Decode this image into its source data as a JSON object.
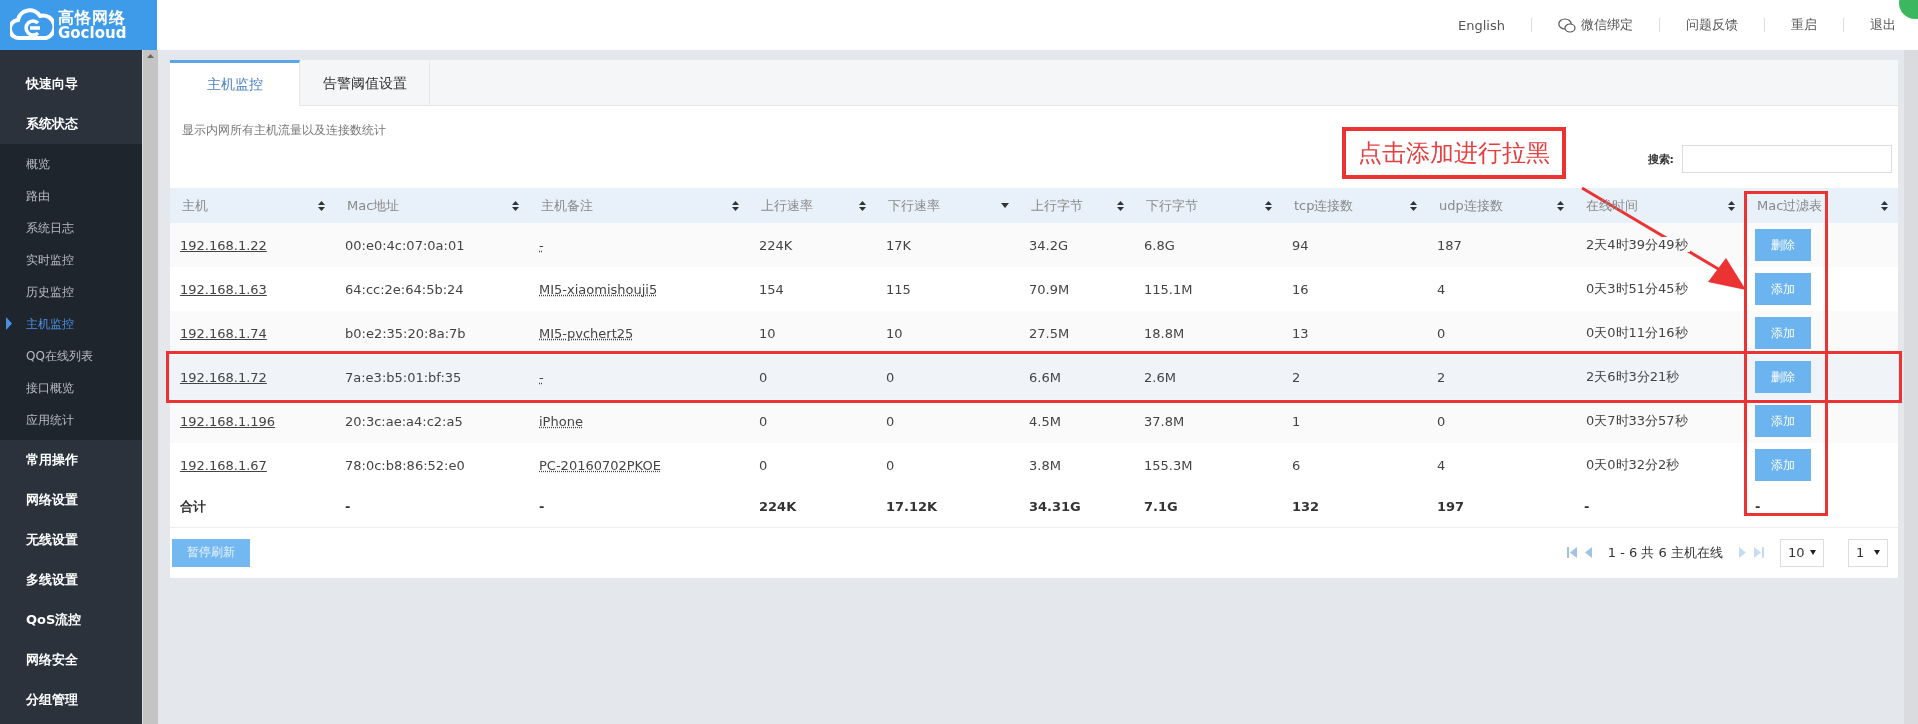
{
  "brand": {
    "name": "高恪网络",
    "subtitle": "Gocloud"
  },
  "top_links": [
    {
      "label": "English",
      "kind": "text"
    },
    {
      "label": "微信绑定",
      "kind": "wechat"
    },
    {
      "label": "问题反馈",
      "kind": "text"
    },
    {
      "label": "重启",
      "kind": "text"
    },
    {
      "label": "退出",
      "kind": "text"
    }
  ],
  "sidebar": {
    "items": [
      {
        "label": "快速向导"
      },
      {
        "label": "系统状态",
        "expanded": true,
        "children": [
          {
            "label": "概览",
            "selected": false
          },
          {
            "label": "路由",
            "selected": false
          },
          {
            "label": "系统日志",
            "selected": false
          },
          {
            "label": "实时监控",
            "selected": false
          },
          {
            "label": "历史监控",
            "selected": false
          },
          {
            "label": "主机监控",
            "selected": true
          },
          {
            "label": "QQ在线列表",
            "selected": false
          },
          {
            "label": "接口概览",
            "selected": false
          },
          {
            "label": "应用统计",
            "selected": false
          }
        ]
      },
      {
        "label": "常用操作"
      },
      {
        "label": "网络设置"
      },
      {
        "label": "无线设置"
      },
      {
        "label": "多线设置"
      },
      {
        "label": "QoS流控"
      },
      {
        "label": "网络安全"
      },
      {
        "label": "分组管理"
      }
    ]
  },
  "tabs": [
    {
      "label": "主机监控",
      "selected": true
    },
    {
      "label": "告警阈值设置",
      "selected": false
    }
  ],
  "description": "显示内网所有主机流量以及连接数统计",
  "search": {
    "label": "搜索:"
  },
  "table": {
    "columns": [
      {
        "label": "主机",
        "sorted_desc": false
      },
      {
        "label": "Mac地址",
        "sorted_desc": false
      },
      {
        "label": "主机备注",
        "sorted_desc": false
      },
      {
        "label": "上行速率",
        "sorted_desc": false
      },
      {
        "label": "下行速率",
        "sorted_desc": true
      },
      {
        "label": "上行字节",
        "sorted_desc": false
      },
      {
        "label": "下行字节",
        "sorted_desc": false
      },
      {
        "label": "tcp连接数",
        "sorted_desc": false
      },
      {
        "label": "udp连接数",
        "sorted_desc": false
      },
      {
        "label": "在线时间",
        "sorted_desc": false
      },
      {
        "label": "Mac过滤表",
        "sorted_desc": false
      }
    ],
    "rows": [
      {
        "host": "192.168.1.22",
        "mac": "00:e0:4c:07:0a:01",
        "note": "-",
        "up_rate": "224K",
        "down_rate": "17K",
        "up_bytes": "34.2G",
        "down_bytes": "6.8G",
        "tcp": "94",
        "udp": "187",
        "online": "2天4时39分49秒",
        "action": "删除",
        "marked": false
      },
      {
        "host": "192.168.1.63",
        "mac": "64:cc:2e:64:5b:24",
        "note": "MI5-xiaomishouji5",
        "up_rate": "154",
        "down_rate": "115",
        "up_bytes": "70.9M",
        "down_bytes": "115.1M",
        "tcp": "16",
        "udp": "4",
        "online": "0天3时51分45秒",
        "action": "添加",
        "marked": false
      },
      {
        "host": "192.168.1.74",
        "mac": "b0:e2:35:20:8a:7b",
        "note": "MI5-pvchert25",
        "up_rate": "10",
        "down_rate": "10",
        "up_bytes": "27.5M",
        "down_bytes": "18.8M",
        "tcp": "13",
        "udp": "0",
        "online": "0天0时11分16秒",
        "action": "添加",
        "marked": false
      },
      {
        "host": "192.168.1.72",
        "mac": "7a:e3:b5:01:bf:35",
        "note": "-",
        "up_rate": "0",
        "down_rate": "0",
        "up_bytes": "6.6M",
        "down_bytes": "2.6M",
        "tcp": "2",
        "udp": "2",
        "online": "2天6时3分21秒",
        "action": "删除",
        "marked": true
      },
      {
        "host": "192.168.1.196",
        "mac": "20:3c:ae:a4:c2:a5",
        "note": "iPhone",
        "up_rate": "0",
        "down_rate": "0",
        "up_bytes": "4.5M",
        "down_bytes": "37.8M",
        "tcp": "1",
        "udp": "0",
        "online": "0天7时33分57秒",
        "action": "添加",
        "marked": false
      },
      {
        "host": "192.168.1.67",
        "mac": "78:0c:b8:86:52:e0",
        "note": "PC-20160702PKOE",
        "up_rate": "0",
        "down_rate": "0",
        "up_bytes": "3.8M",
        "down_bytes": "155.3M",
        "tcp": "6",
        "udp": "4",
        "online": "0天0时32分2秒",
        "action": "添加",
        "marked": false
      }
    ],
    "total": [
      "合计",
      "-",
      "-",
      "224K",
      "17.12K",
      "34.31G",
      "7.1G",
      "132",
      "197",
      "-",
      "-"
    ]
  },
  "pause_button": "暂停刷新",
  "pagination": {
    "summary": "1 - 6 共 6 主机在线",
    "page_size": "10",
    "page": "1"
  },
  "annotation": {
    "text": "点击添加进行拉黑"
  }
}
